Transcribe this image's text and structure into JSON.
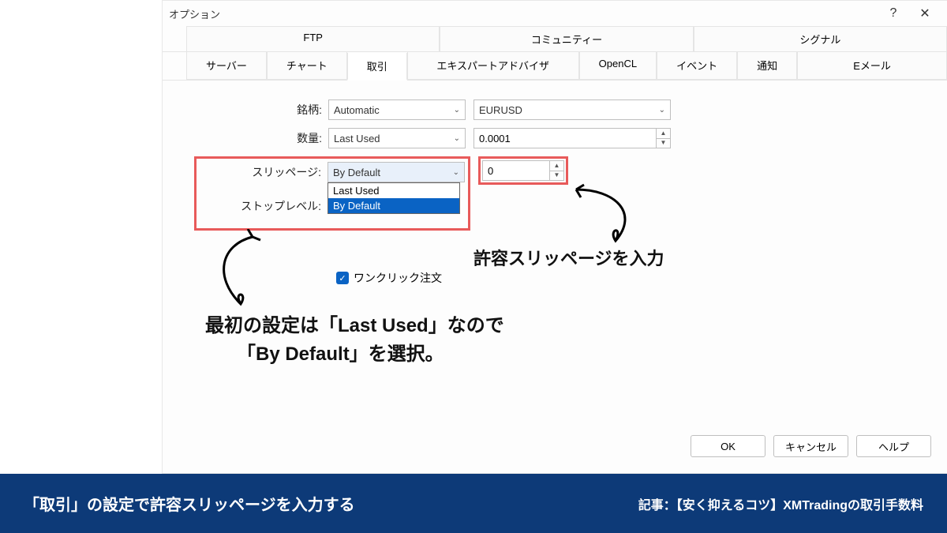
{
  "window": {
    "title": "オプション",
    "help_btn": "?",
    "close_btn": "✕"
  },
  "tabs_row1": [
    "FTP",
    "コミュニティー",
    "シグナル"
  ],
  "tabs_row2": [
    "サーバー",
    "チャート",
    "取引",
    "エキスパートアドバイザ",
    "OpenCL",
    "イベント",
    "通知",
    "Eメール"
  ],
  "active_tab_index": 2,
  "form": {
    "symbol_label": "銘柄:",
    "symbol_value": "Automatic",
    "symbol_field": "EURUSD",
    "volume_label": "数量:",
    "volume_value": "Last Used",
    "volume_num": "0.0001",
    "slippage_label": "スリッページ:",
    "slippage_value": "By Default",
    "slippage_num": "0",
    "slippage_options": [
      "Last Used",
      "By Default"
    ],
    "stoplevel_label": "ストップレベル:",
    "oneclick_label": "ワンクリック注文"
  },
  "buttons": {
    "ok": "OK",
    "cancel": "キャンセル",
    "help": "ヘルプ"
  },
  "annotations": {
    "right": "許容スリッページを入力",
    "left_line1": "最初の設定は「Last Used」なので",
    "left_line2": "「By Default」を選択。"
  },
  "footer": {
    "left": "「取引」の設定で許容スリッページを入力する",
    "right": "記事：【安く抑えるコツ】XMTradingの取引手数料"
  }
}
